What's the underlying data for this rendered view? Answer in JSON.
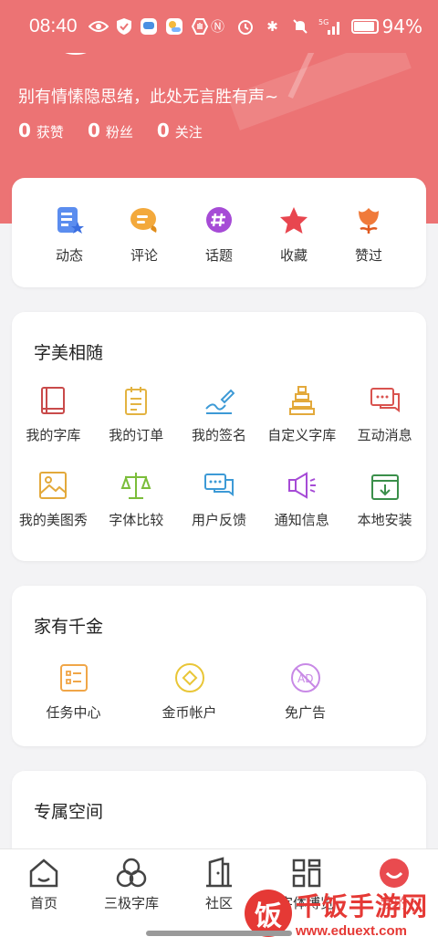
{
  "status_bar": {
    "time": "08:40",
    "battery": "94%",
    "battery_level": 0.94,
    "network": "5G"
  },
  "profile": {
    "bio": "别有情愫隐思绪，此处无言胜有声~",
    "stats": [
      {
        "num": "0",
        "label": "获赞"
      },
      {
        "num": "0",
        "label": "粉丝"
      },
      {
        "num": "0",
        "label": "关注"
      }
    ]
  },
  "quick_actions": [
    {
      "label": "动态",
      "icon": "post-icon"
    },
    {
      "label": "评论",
      "icon": "comment-icon"
    },
    {
      "label": "话题",
      "icon": "topic-icon"
    },
    {
      "label": "收藏",
      "icon": "star-icon"
    },
    {
      "label": "赞过",
      "icon": "tulip-icon"
    }
  ],
  "section_font": {
    "title": "字美相随",
    "items": [
      {
        "label": "我的字库",
        "icon": "book-icon"
      },
      {
        "label": "我的订单",
        "icon": "order-icon"
      },
      {
        "label": "我的签名",
        "icon": "signature-icon"
      },
      {
        "label": "自定义字库",
        "icon": "tower-icon"
      },
      {
        "label": "互动消息",
        "icon": "chat-icon"
      },
      {
        "label": "我的美图秀",
        "icon": "image-icon"
      },
      {
        "label": "字体比较",
        "icon": "scale-icon"
      },
      {
        "label": "用户反馈",
        "icon": "feedback-icon"
      },
      {
        "label": "通知信息",
        "icon": "megaphone-icon"
      },
      {
        "label": "本地安装",
        "icon": "install-icon"
      }
    ]
  },
  "section_coins": {
    "title": "家有千金",
    "items": [
      {
        "label": "任务中心",
        "icon": "task-icon"
      },
      {
        "label": "金币帐户",
        "icon": "coin-icon"
      },
      {
        "label": "免广告",
        "icon": "no-ad-icon"
      }
    ]
  },
  "section_space": {
    "title": "专属空间"
  },
  "tab_bar": [
    {
      "label": "首页",
      "icon": "home-icon"
    },
    {
      "label": "三极字库",
      "icon": "circles-icon"
    },
    {
      "label": "社区",
      "icon": "door-icon"
    },
    {
      "label": "字体博览",
      "icon": "grid-icon"
    },
    {
      "label": "我的",
      "icon": "smile-icon",
      "active": true
    }
  ],
  "watermark": {
    "logo_char": "饭",
    "title": "千饭手游网",
    "url": "www.eduext.com"
  }
}
